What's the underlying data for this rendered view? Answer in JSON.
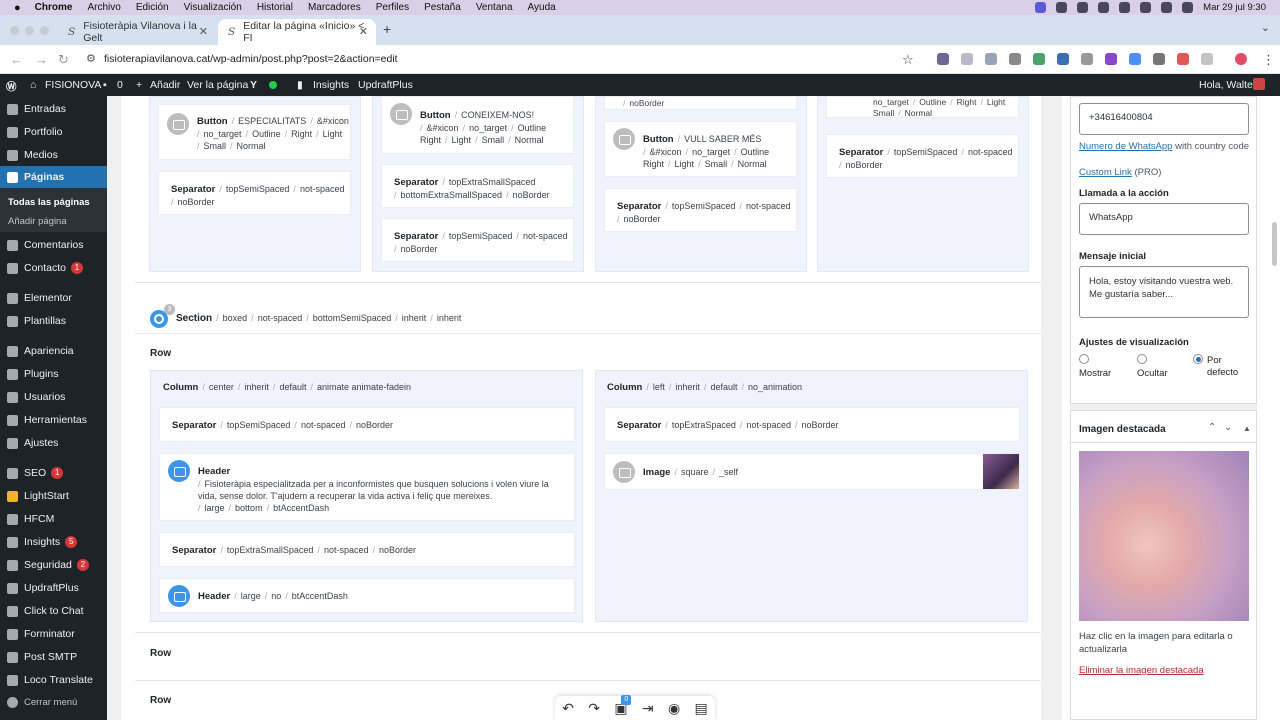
{
  "mac": {
    "menus": [
      "Chrome",
      "Archivo",
      "Edición",
      "Visualización",
      "Historial",
      "Marcadores",
      "Perfiles",
      "Pestaña",
      "Ventana",
      "Ayuda"
    ],
    "datetime": "Mar 29 jul 9:30"
  },
  "tabs": [
    {
      "title": "Fisioteràpia Vilanova i la Gelt"
    },
    {
      "title": "Editar la página «Inicio» < FI"
    }
  ],
  "url": "fisioterapiavilanova.cat/wp-admin/post.php?post=2&action=edit",
  "adminbar": {
    "site": "FISIONOVA",
    "comments": "0",
    "add": "Añadir",
    "view": "Ver la página",
    "insights": "Insights",
    "updraft": "UpdraftPlus",
    "greeting": "Hola, Walter"
  },
  "sidebar": {
    "items": [
      {
        "label": "Entradas"
      },
      {
        "label": "Portfolio"
      },
      {
        "label": "Medios"
      },
      {
        "label": "Páginas"
      },
      {
        "label": "Comentarios"
      },
      {
        "label": "Contacto",
        "badge": "1"
      },
      {
        "label": "Elementor"
      },
      {
        "label": "Plantillas"
      },
      {
        "label": "Apariencia"
      },
      {
        "label": "Plugins"
      },
      {
        "label": "Usuarios"
      },
      {
        "label": "Herramientas"
      },
      {
        "label": "Ajustes"
      },
      {
        "label": "SEO",
        "badge": "1"
      },
      {
        "label": "LightStart"
      },
      {
        "label": "HFCM"
      },
      {
        "label": "Insights",
        "badge": "5"
      },
      {
        "label": "Seguridad",
        "badge": "2"
      },
      {
        "label": "UpdraftPlus"
      },
      {
        "label": "Click to Chat"
      },
      {
        "label": "Forminator"
      },
      {
        "label": "Post SMTP"
      },
      {
        "label": "Loco Translate"
      },
      {
        "label": "Cerrar menú"
      }
    ],
    "sub": [
      "Todas las páginas",
      "Añadir página"
    ]
  },
  "editor": {
    "top": {
      "c1_button": {
        "name": "Button",
        "line1": "ESPECIALITATS",
        "line1b": "&#xicon",
        "line2": [
          "no_target",
          "Outline",
          "Right",
          "Light"
        ],
        "line3": [
          "Small",
          "Normal"
        ]
      },
      "c1_sep": {
        "name": "Separator",
        "line1": [
          "topSemiSpaced",
          "not-spaced"
        ],
        "line2": "noBorder"
      },
      "c2_button": {
        "name": "Button",
        "line1": "CONEIXEM-NOS!",
        "line2": [
          "&#xicon",
          "no_target",
          "Outline"
        ],
        "line3": [
          "Right",
          "Light",
          "Small",
          "Normal"
        ]
      },
      "c2_sep1": {
        "name": "Separator",
        "line1": "topExtraSmallSpaced",
        "line2": [
          "bottomExtraSmallSpaced",
          "noBorder"
        ]
      },
      "c2_sep2": {
        "name": "Separator",
        "line1": [
          "topSemiSpaced",
          "not-spaced"
        ],
        "line2": "noBorder"
      },
      "c3_top": "noBorder",
      "c3_button": {
        "name": "Button",
        "line1": "VULL SABER MÉS",
        "line2": [
          "&#xicon",
          "no_target",
          "Outline"
        ],
        "line3": [
          "Right",
          "Light",
          "Small",
          "Normal"
        ]
      },
      "c3_sep": {
        "name": "Separator",
        "line1": [
          "topSemiSpaced",
          "not-spaced"
        ],
        "line2": "noBorder"
      },
      "c4_top": [
        "no_target",
        "Outline",
        "Right",
        "Light"
      ],
      "c4_top2": [
        "Small",
        "Normal"
      ],
      "c4_sep": {
        "name": "Separator",
        "line1": [
          "topSemiSpaced",
          "not-spaced"
        ],
        "line2": "noBorder"
      }
    },
    "section": {
      "name": "Section",
      "badge": "3",
      "attrs": [
        "boxed",
        "not-spaced",
        "bottomSemiSpaced",
        "inherit",
        "inherit"
      ]
    },
    "row_label": "Row",
    "colA": {
      "name": "Column",
      "attrs": [
        "center",
        "inherit",
        "default",
        "animate animate-fadein"
      ],
      "sep1": {
        "name": "Separator",
        "attrs": [
          "topSemiSpaced",
          "not-spaced",
          "noBorder"
        ]
      },
      "header": {
        "name": "Header",
        "text": "Fisioteràpia especialitzada per a inconformistes que busquen solucions i volen viure la vida, sense dolor. T'ajudem a recuperar la vida activa i feliç que mereixes.",
        "attrs": [
          "large",
          "bottom",
          "btAccentDash"
        ]
      },
      "sep2": {
        "name": "Separator",
        "attrs": [
          "topExtraSmallSpaced",
          "not-spaced",
          "noBorder"
        ]
      },
      "header2": {
        "name": "Header",
        "attrs": [
          "large",
          "no",
          "btAccentDash"
        ]
      }
    },
    "colB": {
      "name": "Column",
      "attrs": [
        "left",
        "inherit",
        "default",
        "no_animation"
      ],
      "sep": {
        "name": "Separator",
        "attrs": [
          "topExtraSpaced",
          "not-spaced",
          "noBorder"
        ]
      },
      "image": {
        "name": "Image",
        "attrs": [
          "square",
          "_self"
        ]
      }
    },
    "row2": "Row",
    "row3": "Row",
    "toolbar_badge": "0"
  },
  "panel": {
    "phone": "+34616400804",
    "whatsapp_link": "Numero de WhatsApp",
    "whatsapp_rest": " with country code",
    "custom_link": "Custom Link",
    "pro": " (PRO)",
    "cta_label": "Llamada a la acción",
    "cta_value": "WhatsApp",
    "msg_label": "Mensaje inicial",
    "msg_value": "Hola, estoy visitando vuestra web. Me gustaría saber...",
    "display_label": "Ajustes de visualización",
    "options": [
      "Mostrar",
      "Ocultar",
      "Por defecto"
    ],
    "featured_title": "Imagen destacada",
    "featured_hint": "Haz clic en la imagen para editarla o actualizarla",
    "remove_link": "Eliminar la imagen destacada"
  }
}
